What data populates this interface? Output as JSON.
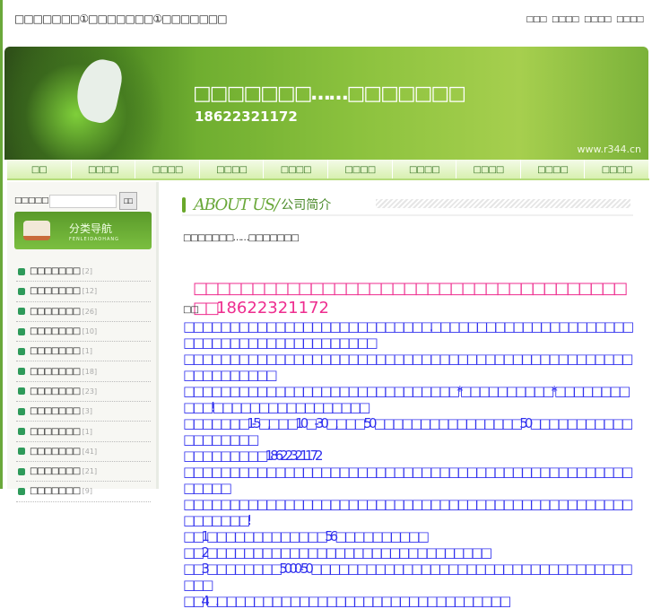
{
  "header": {
    "title": "□□□□□□□①□□□□□□□①□□□□□□□",
    "links": [
      "□□□",
      "□□□□",
      "□□□□",
      "□□□□"
    ]
  },
  "banner": {
    "title": "□□□□□□□……□□□□□□□",
    "phone": "18622321172",
    "url": "www.r344.cn"
  },
  "nav": [
    "□□",
    "□□□□",
    "□□□□",
    "□□□□",
    "□□□□",
    "□□□□",
    "□□□□",
    "□□□□",
    "□□□□",
    "□□□□"
  ],
  "sidebar": {
    "search_label": "□□□□□",
    "search_button": "□□",
    "catnav_title": "分类导航",
    "catnav_sub": "FENLEIDAOHANG",
    "categories": [
      {
        "name": "□□□□□□□",
        "count": "[2]"
      },
      {
        "name": "□□□□□□□",
        "count": "[12]"
      },
      {
        "name": "□□□□□□□",
        "count": "[26]"
      },
      {
        "name": "□□□□□□□",
        "count": "[10]"
      },
      {
        "name": "□□□□□□□",
        "count": "[1]"
      },
      {
        "name": "□□□□□□□",
        "count": "[18]"
      },
      {
        "name": "□□□□□□□",
        "count": "[23]"
      },
      {
        "name": "□□□□□□□",
        "count": "[3]"
      },
      {
        "name": "□□□□□□□",
        "count": "[1]"
      },
      {
        "name": "□□□□□□□",
        "count": "[41]"
      },
      {
        "name": "□□□□□□□",
        "count": "[21]"
      },
      {
        "name": "□□□□□□□",
        "count": "[9]"
      }
    ]
  },
  "main": {
    "heading_en": "ABOUT US/",
    "heading_cn": "公司简介",
    "intro": "□□□□□□□……□□□□□□□",
    "pink_boxes": "□□□□□□□□□□□□□□□□□□□□□□□□□□□□□□□□□□□□□□□",
    "pink_phone": "18622321172",
    "small": "□□",
    "lines": [
      "□□□□□□□□□□□□□□□□□□□□□□□□□□□.□□□□□□□□□□□□□□□□□□□□□□□□□□□□□□□□□□□□□□□□□□□",
      "□□□□□□□□□□□□□□□□□□□□□□□□□□□□□□□□□□□□□□□□□□□□□□□□□□□□□□□□□□□",
      "□□□□□□□□□□□□□□□□□□□□□□□□□□□□□□*□□□□□□□□□□*□□□□□□□□□□□!□□□□□□□□□□□□□□□□□",
      "□□□□□□□1-5□,□□□10□-30□,□□□:50□□□□□□□□□□□□□□□□50□□□□□□□□□□□□□□□□□□□",
      "□□□□□□□□□18622321172",
      "□□□□□□□□□□□□□□□□□□□□□□□□□□□□□□□□□□□□□□□□□□□□□□□□□□□□□□",
      "□□□□□□□□□□□□□□□□□□□□□□□□□□□□□□□□□□□□□□□□□□□□□□□□□□□□□□□□!",
      "□□1□□□□□□□□□□□□□56□□□□□□□□□□",
      "□□2□□□□□□□□□□□□□□□□□□□□□□□□□□□□□□□",
      "□□3□□□□□□□□5000-50□□□□□□□□□□□□□□□□□□□□□□□□□□□□□□□□□□□□□□",
      "□□4□.□□□□□□□□□□□□□□□□□□□□□□□□□□□□□□□□"
    ]
  }
}
